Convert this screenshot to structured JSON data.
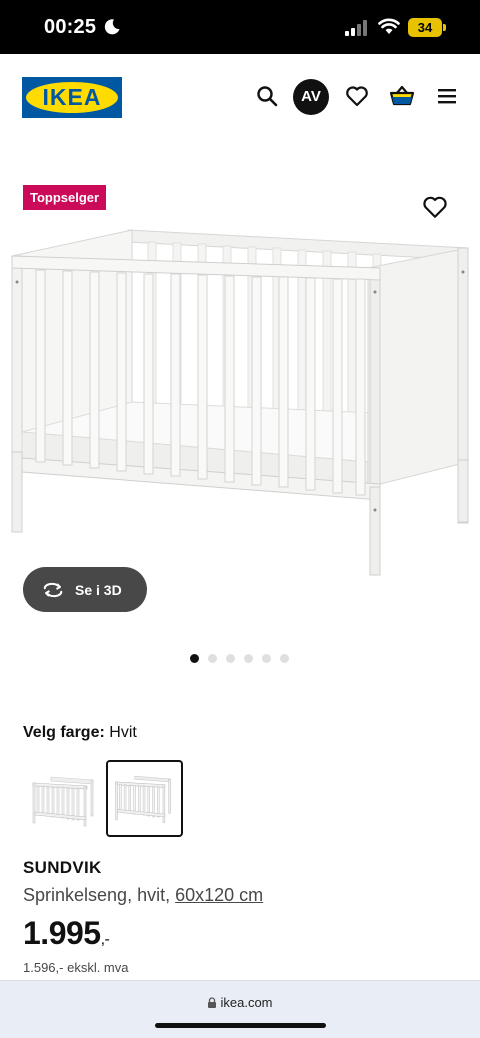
{
  "status_bar": {
    "time": "00:25",
    "battery": "34"
  },
  "header": {
    "logo_text": "IKEA",
    "icons": [
      "search-icon",
      "heart-icon",
      "basket-icon",
      "menu-icon"
    ],
    "avatar_initials": "AV"
  },
  "gallery": {
    "badge": "Toppselger",
    "view_3d_label": "Se i 3D",
    "dot_count": 6,
    "active_dot": 1
  },
  "color_picker": {
    "label": "Velg farge:",
    "selected_value": "Hvit"
  },
  "product": {
    "name": "SUNDVIK",
    "description": "Sprinkelseng, hvit,",
    "size": "60x120 cm",
    "price": "1.995",
    "price_suffix": ",-",
    "price_excl_vat": "1.596,- ekskl. mva"
  },
  "browser": {
    "url": "ikea.com"
  },
  "colors": {
    "badge": "#cc0a5a",
    "brand_blue": "#0058a3",
    "brand_yellow": "#ffdb00",
    "button_3d": "#484848"
  }
}
